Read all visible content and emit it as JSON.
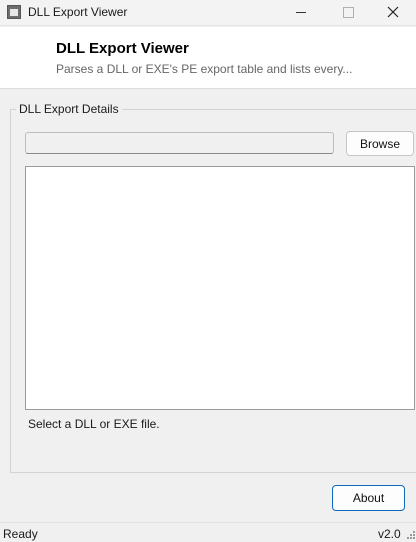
{
  "window": {
    "title": "DLL Export Viewer"
  },
  "header": {
    "title": "DLL Export Viewer",
    "subtitle": "Parses a DLL or EXE's PE export table and lists every..."
  },
  "group": {
    "label": "DLL Export Details",
    "path_value": "",
    "browse_label": "Browse",
    "output_text": "",
    "hint": "Select a DLL or EXE file."
  },
  "footer": {
    "about_label": "About"
  },
  "statusbar": {
    "status": "Ready",
    "version": "v2.0"
  },
  "icons": {
    "app": "app-window-icon",
    "minimize": "minimize-icon",
    "maximize": "maximize-icon",
    "close": "close-icon",
    "grip": "resize-grip-icon"
  },
  "colors": {
    "accent": "#0f6cbd",
    "window_bg": "#f0f0f0",
    "header_bg": "#ffffff"
  }
}
